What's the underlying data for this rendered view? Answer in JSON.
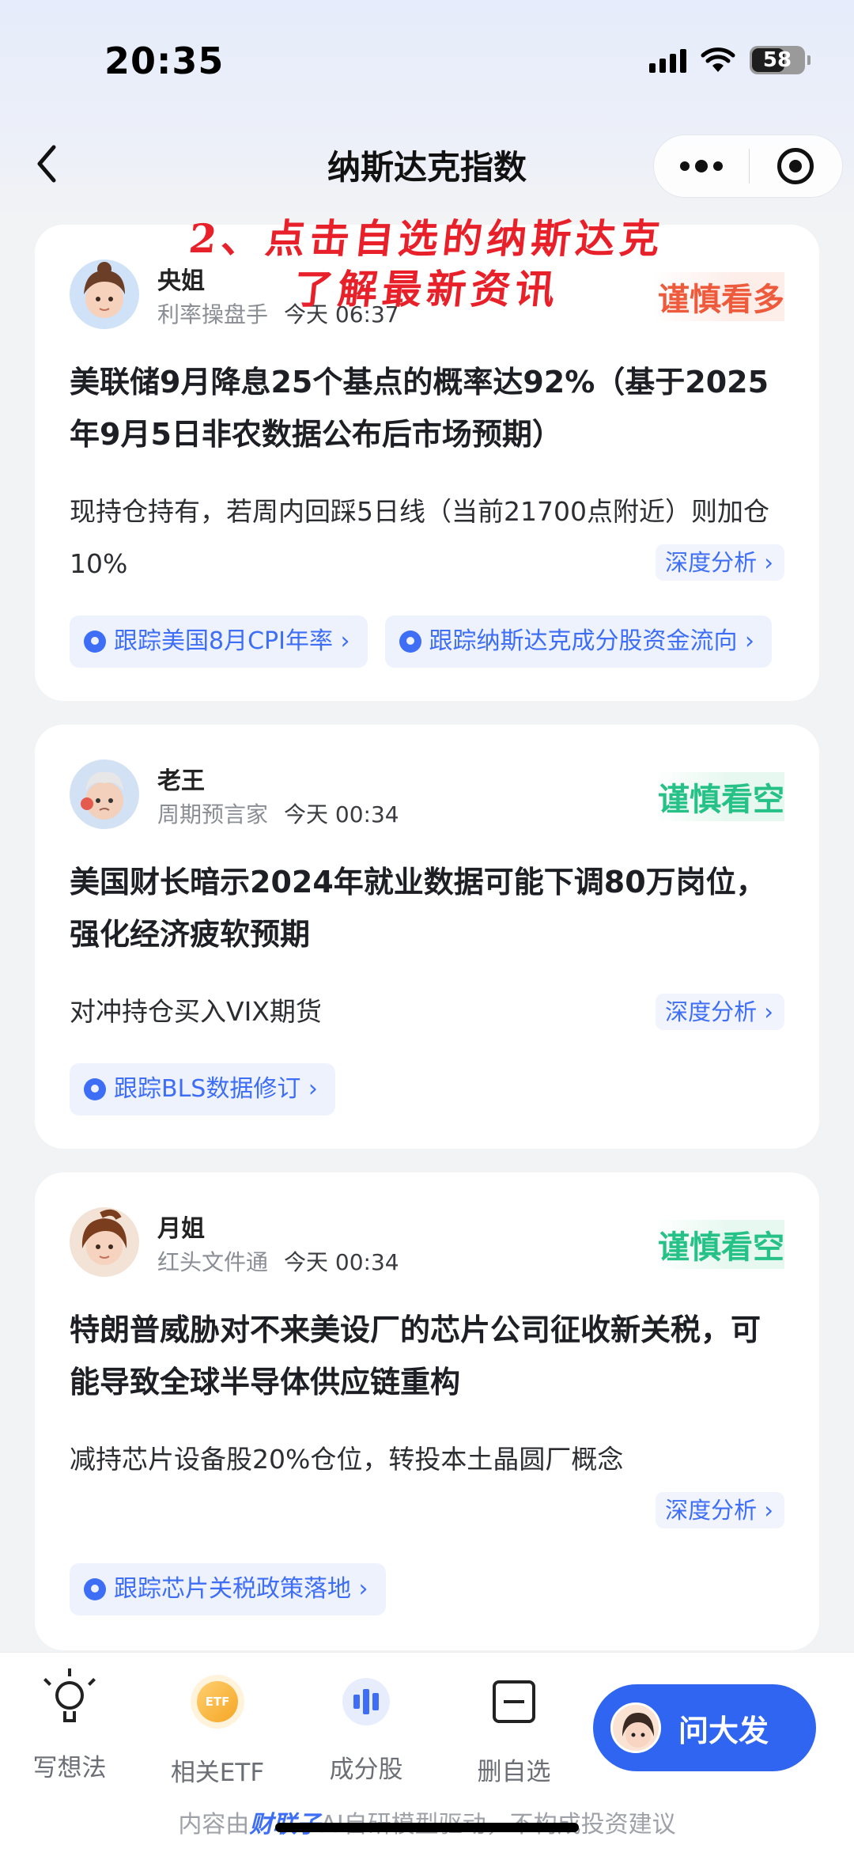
{
  "status_bar": {
    "time": "20:35",
    "battery": "58"
  },
  "nav": {
    "title": "纳斯达克指数",
    "back": "<"
  },
  "annotation": {
    "line1": "2、点击自选的纳斯达克",
    "line2": "了解最新资讯"
  },
  "posts": [
    {
      "author": "央姐",
      "role": "利率操盘手",
      "time": "今天 06:37",
      "sentiment": "谨慎看多",
      "sentiment_color": "#ee5a3c",
      "title": "美联储9月降息25个基点的概率达92%（基于2025年9月5日非农数据公布后市场预期）",
      "body": "现持仓持有，若周内回踩5日线（当前21700点附近）则加仓10%",
      "deep": "深度分析 ›",
      "tags": [
        "跟踪美国8月CPI年率 ›",
        "跟踪纳斯达克成分股资金流向 ›"
      ]
    },
    {
      "author": "老王",
      "role": "周期预言家",
      "time": "今天 00:34",
      "sentiment": "谨慎看空",
      "sentiment_color": "#25c186",
      "title": "美国财长暗示2024年就业数据可能下调80万岗位，强化经济疲软预期",
      "body": "对冲持仓买入VIX期货",
      "deep": "深度分析 ›",
      "tags": [
        "跟踪BLS数据修订 ›"
      ]
    },
    {
      "author": "月姐",
      "role": "红头文件通",
      "time": "今天 00:34",
      "sentiment": "谨慎看空",
      "sentiment_color": "#25c186",
      "title": "特朗普威胁对不来美设厂的芯片公司征收新关税，可能导致全球半导体供应链重构",
      "body": "减持芯片设备股20%仓位，转投本土晶圆厂概念",
      "deep": "深度分析 ›",
      "tags": [
        "跟踪芯片关税政策落地 ›"
      ]
    }
  ],
  "tabbar": {
    "tabs": [
      {
        "label": "写想法",
        "icon": "lightbulb-icon"
      },
      {
        "label": "相关ETF",
        "icon": "etf-icon",
        "icon_text": "ETF"
      },
      {
        "label": "成分股",
        "icon": "candlestick-icon"
      },
      {
        "label": "删自选",
        "icon": "remove-watchlist-icon"
      }
    ],
    "ask_button": "问大发",
    "footer_prefix": "内容由",
    "footer_brand": "财联子",
    "footer_suffix": "AI自研模型驱动，不构成投资建议"
  },
  "colors": {
    "accent": "#3e6ef5",
    "bull": "#ee5a3c",
    "bear": "#25c186",
    "ask_button": "#2f65f0"
  }
}
